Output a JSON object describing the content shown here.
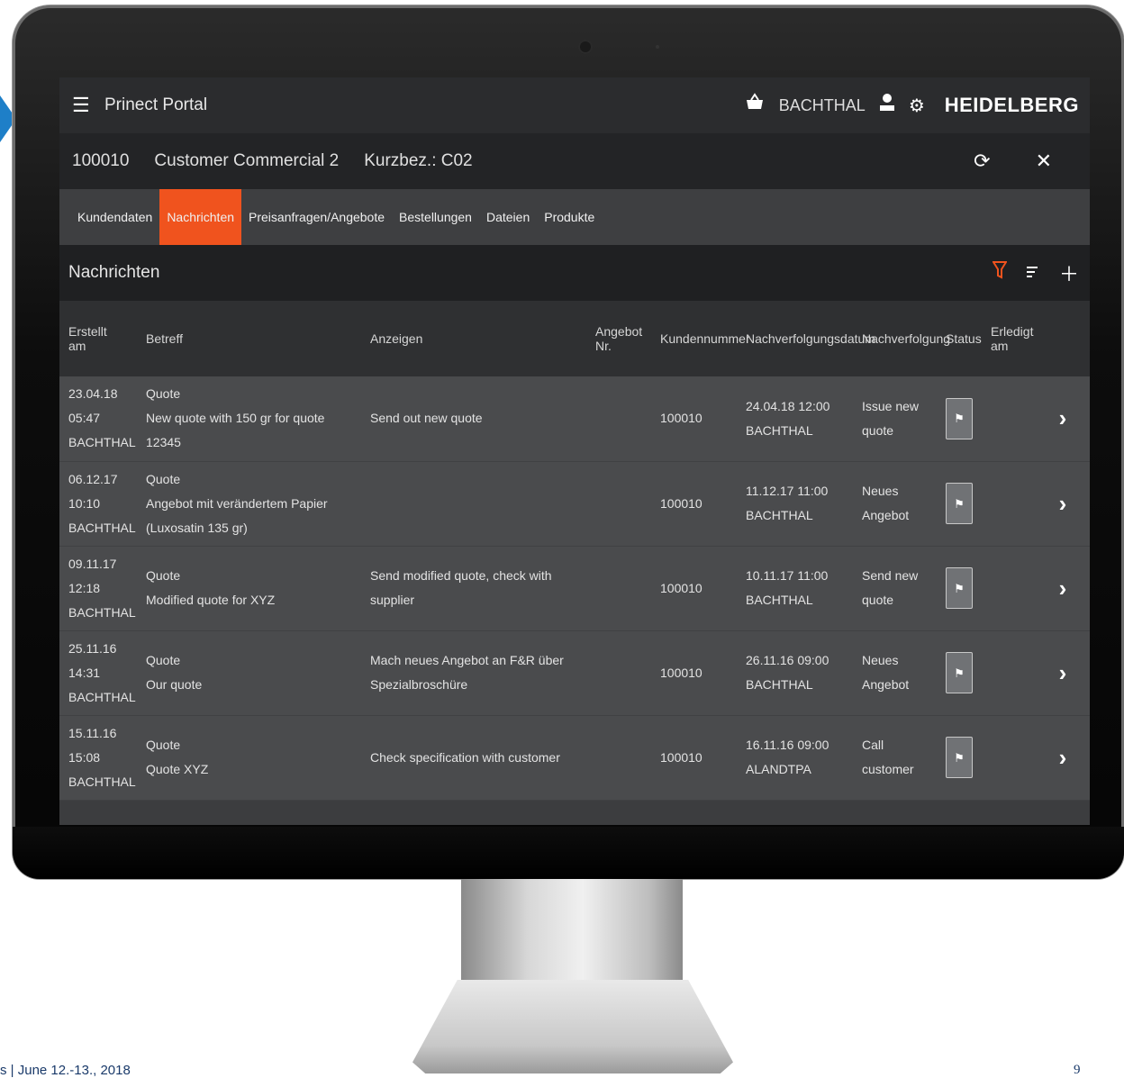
{
  "app": {
    "title": "Prinect Portal",
    "user": "BACHTHAL",
    "brand": "HEIDELBERG",
    "icons": {
      "menu": "hamburger-icon",
      "cart": "cart-icon",
      "user": "user-icon",
      "settings": "gear-icon"
    }
  },
  "customer": {
    "number": "100010",
    "name": "Customer Commercial 2",
    "short": "Kurzbez.: C02"
  },
  "tabs": [
    {
      "label": "Kundendaten",
      "active": false
    },
    {
      "label": "Nachrichten",
      "active": true
    },
    {
      "label": "Preisanfragen/Angebote",
      "active": false
    },
    {
      "label": "Bestellungen",
      "active": false
    },
    {
      "label": "Dateien",
      "active": false
    },
    {
      "label": "Produkte",
      "active": false
    }
  ],
  "section": {
    "title": "Nachrichten"
  },
  "columns": {
    "created": "Erstellt am",
    "subject": "Betreff",
    "notes": "Anzeigen",
    "offer1": "Angebot",
    "offer2": "Nr.",
    "customer_no": "Kundennummer",
    "followup_date": "Nachverfolgungsdatum",
    "followup": "Nachverfolgung",
    "status": "Status",
    "done1": "Erledigt",
    "done2": "am"
  },
  "rows": [
    {
      "date": "23.04.18",
      "time": "05:47",
      "user": "BACHTHAL",
      "type": "Quote",
      "subject": "New quote with 150 gr for quote 12345",
      "notes": "Send out new quote",
      "offer": "",
      "customer_no": "100010",
      "fu_date": "24.04.18 12:00",
      "fu_user": "BACHTHAL",
      "followup": "Issue new quote",
      "done": ""
    },
    {
      "date": "06.12.17",
      "time": "10:10",
      "user": "BACHTHAL",
      "type": "Quote",
      "subject": "Angebot mit verändertem Papier (Luxosatin 135 gr)",
      "notes": "",
      "offer": "",
      "customer_no": "100010",
      "fu_date": "11.12.17 11:00",
      "fu_user": "BACHTHAL",
      "followup": "Neues Angebot",
      "done": ""
    },
    {
      "date": "09.11.17",
      "time": "12:18",
      "user": "BACHTHAL",
      "type": "Quote",
      "subject": "Modified quote for XYZ",
      "notes": "Send modified quote, check with supplier",
      "offer": "",
      "customer_no": "100010",
      "fu_date": "10.11.17 11:00",
      "fu_user": "BACHTHAL",
      "followup": "Send new quote",
      "done": ""
    },
    {
      "date": "25.11.16",
      "time": "14:31",
      "user": "BACHTHAL",
      "type": "Quote",
      "subject": "Our quote",
      "notes": "Mach neues Angebot an F&R über Spezialbroschüre",
      "offer": "",
      "customer_no": "100010",
      "fu_date": "26.11.16 09:00",
      "fu_user": "BACHTHAL",
      "followup": "Neues Angebot",
      "done": ""
    },
    {
      "date": "15.11.16",
      "time": "15:08",
      "user": "BACHTHAL",
      "type": "Quote",
      "subject": "Quote XYZ",
      "notes": "Check specification with customer",
      "offer": "",
      "customer_no": "100010",
      "fu_date": "16.11.16 09:00",
      "fu_user": "ALANDTPA",
      "followup": "Call customer",
      "done": ""
    }
  ],
  "footer": {
    "left": "s | June 12.-13., 2018",
    "page": "9"
  },
  "colors": {
    "accent": "#f0531e",
    "topbar": "#2b2c2e",
    "row": "#4a4b4d"
  }
}
